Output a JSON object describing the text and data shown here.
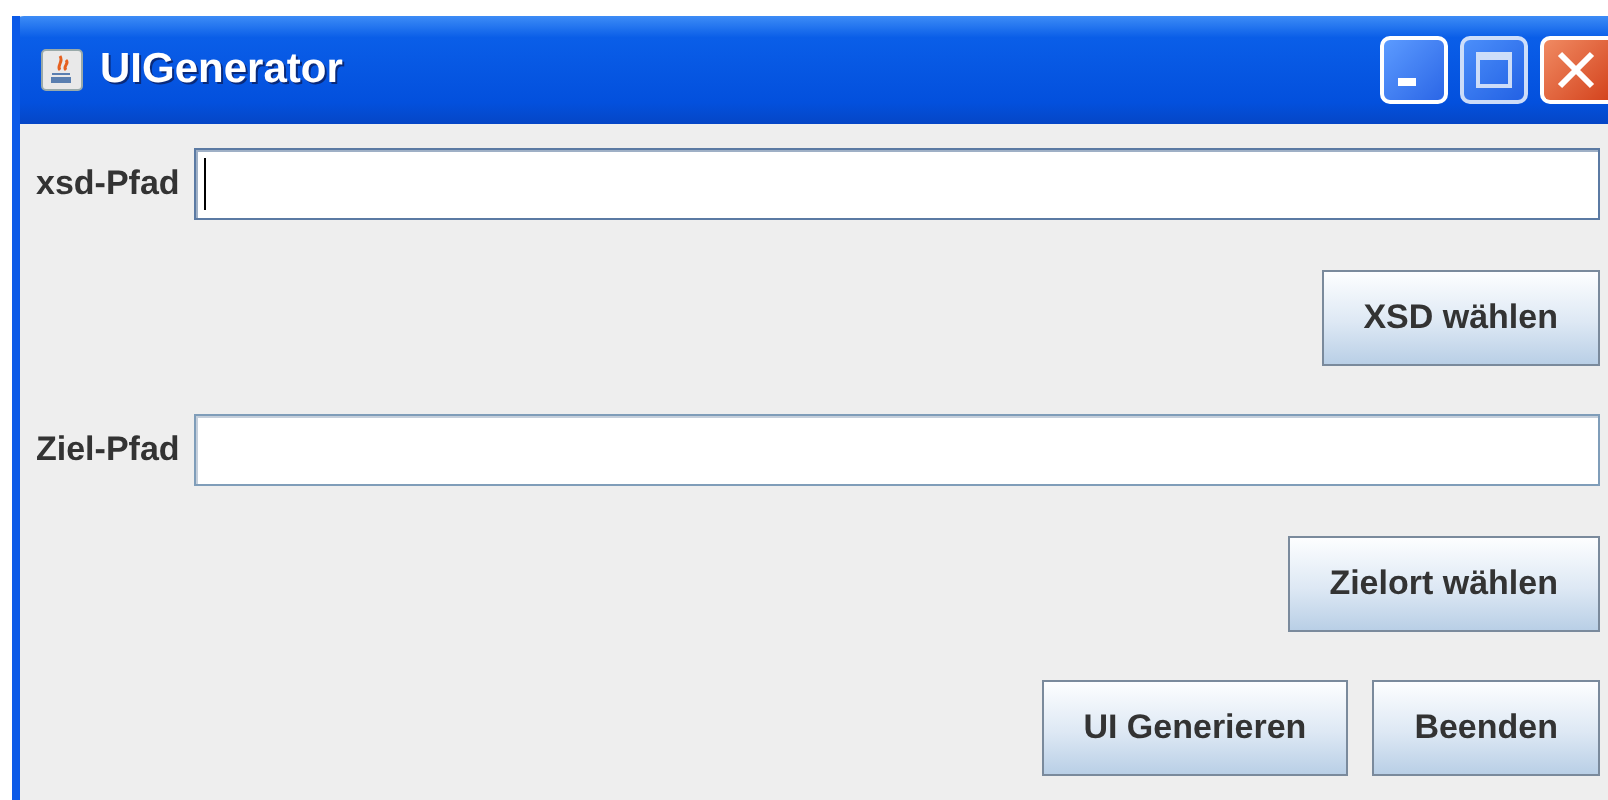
{
  "window": {
    "title": "UIGenerator"
  },
  "rows": [
    {
      "kind": "field",
      "label": "xsd-Pfad",
      "focused": true
    },
    {
      "kind": "button",
      "label": "XSD wählen"
    },
    {
      "kind": "field",
      "label": "Ziel-Pfad",
      "focused": false
    },
    {
      "kind": "button",
      "label": "Zielort wählen"
    }
  ],
  "buttons": [
    "UI Generieren",
    "Beenden"
  ]
}
